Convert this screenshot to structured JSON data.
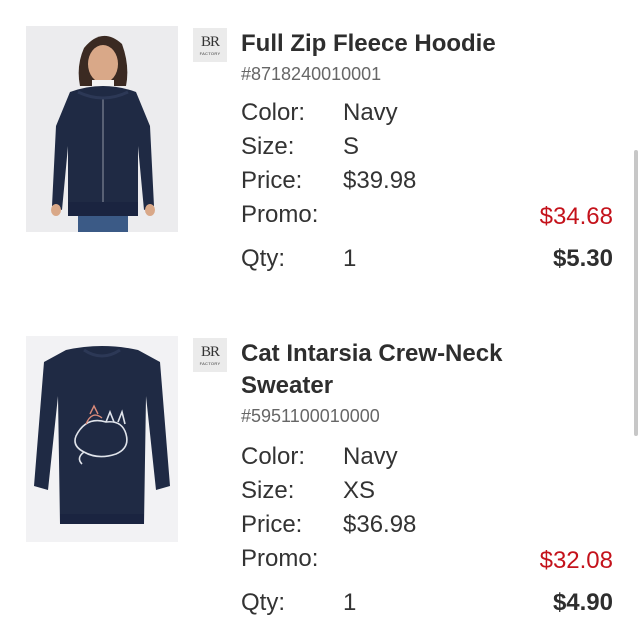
{
  "colors": {
    "promo_red": "#c4121b",
    "text_dark": "#2e2e2e",
    "text_muted": "#666666"
  },
  "brand_badge": {
    "monogram": "BR",
    "subtext": "FACTORY"
  },
  "items": [
    {
      "title": "Full Zip Fleece Hoodie",
      "sku": "#8718240010001",
      "color_label": "Color:",
      "color_value": "Navy",
      "size_label": "Size:",
      "size_value": "S",
      "price_label": "Price:",
      "price_value": "$39.98",
      "promo_label": "Promo:",
      "promo_price": "$34.68",
      "qty_label": "Qty:",
      "qty_value": "1",
      "savings": "$5.30",
      "image_icon": "hoodie-product-photo"
    },
    {
      "title": "Cat Intarsia Crew-Neck Sweater",
      "sku": "#5951100010000",
      "color_label": "Color:",
      "color_value": "Navy",
      "size_label": "Size:",
      "size_value": "XS",
      "price_label": "Price:",
      "price_value": "$36.98",
      "promo_label": "Promo:",
      "promo_price": "$32.08",
      "qty_label": "Qty:",
      "qty_value": "1",
      "savings": "$4.90",
      "image_icon": "sweater-product-photo"
    }
  ]
}
